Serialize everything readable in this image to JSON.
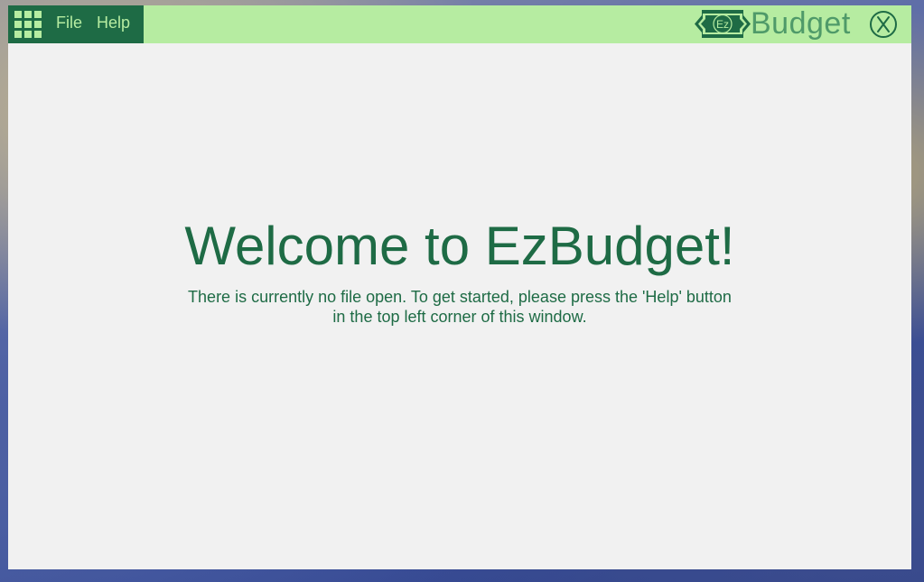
{
  "menu": {
    "file_label": "File",
    "help_label": "Help"
  },
  "brand": {
    "logo_text": "Ez",
    "name": "Budget"
  },
  "welcome": {
    "title": "Welcome to EzBudget!",
    "message": "There is currently no file open. To get started, please press the 'Help' button in the top left corner of this window."
  },
  "icons": {
    "apps": "grid-icon",
    "logo": "ez-money-logo-icon",
    "close": "close-icon"
  },
  "colors": {
    "topbar": "#b6eca1",
    "accent_dark": "#1e6b45",
    "brand_text": "#4f9a69",
    "content_bg": "#f1f1f1"
  }
}
